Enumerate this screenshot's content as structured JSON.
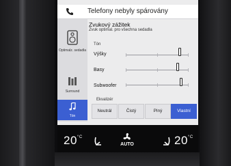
{
  "phone": {
    "label": "Telefony nebyly spárovány"
  },
  "sidebar": {
    "items": [
      {
        "label": "Optimalz. sedadla",
        "icon": "speaker-seat-icon"
      },
      {
        "label": "Surround",
        "icon": "surround-icon"
      },
      {
        "label": "Tón",
        "icon": "music-note-icon",
        "active": true
      }
    ]
  },
  "content": {
    "title": "Zvukový zážitek",
    "subtitle": "Zvuk optimal. pro všechna sedadla",
    "tone_header": "Tón",
    "sliders": [
      {
        "label": "Výšky",
        "level": 0.75
      },
      {
        "label": "Basy",
        "level": 0.72
      },
      {
        "label": "Subwoofer",
        "level": 0.78
      }
    ],
    "equalizer_header": "Ekvalizér",
    "equalizer_options": [
      "Neutrál",
      "Čistý",
      "Plný",
      "Vlastní"
    ],
    "equalizer_selected": "Vlastní"
  },
  "climate": {
    "left_temp": "20",
    "right_temp": "20",
    "unit": "°C",
    "auto_label": "AUTO"
  },
  "colors": {
    "accent": "#3b5fd2",
    "screen_bg": "#ececed",
    "sidebar_bg": "#dcdcdf"
  }
}
